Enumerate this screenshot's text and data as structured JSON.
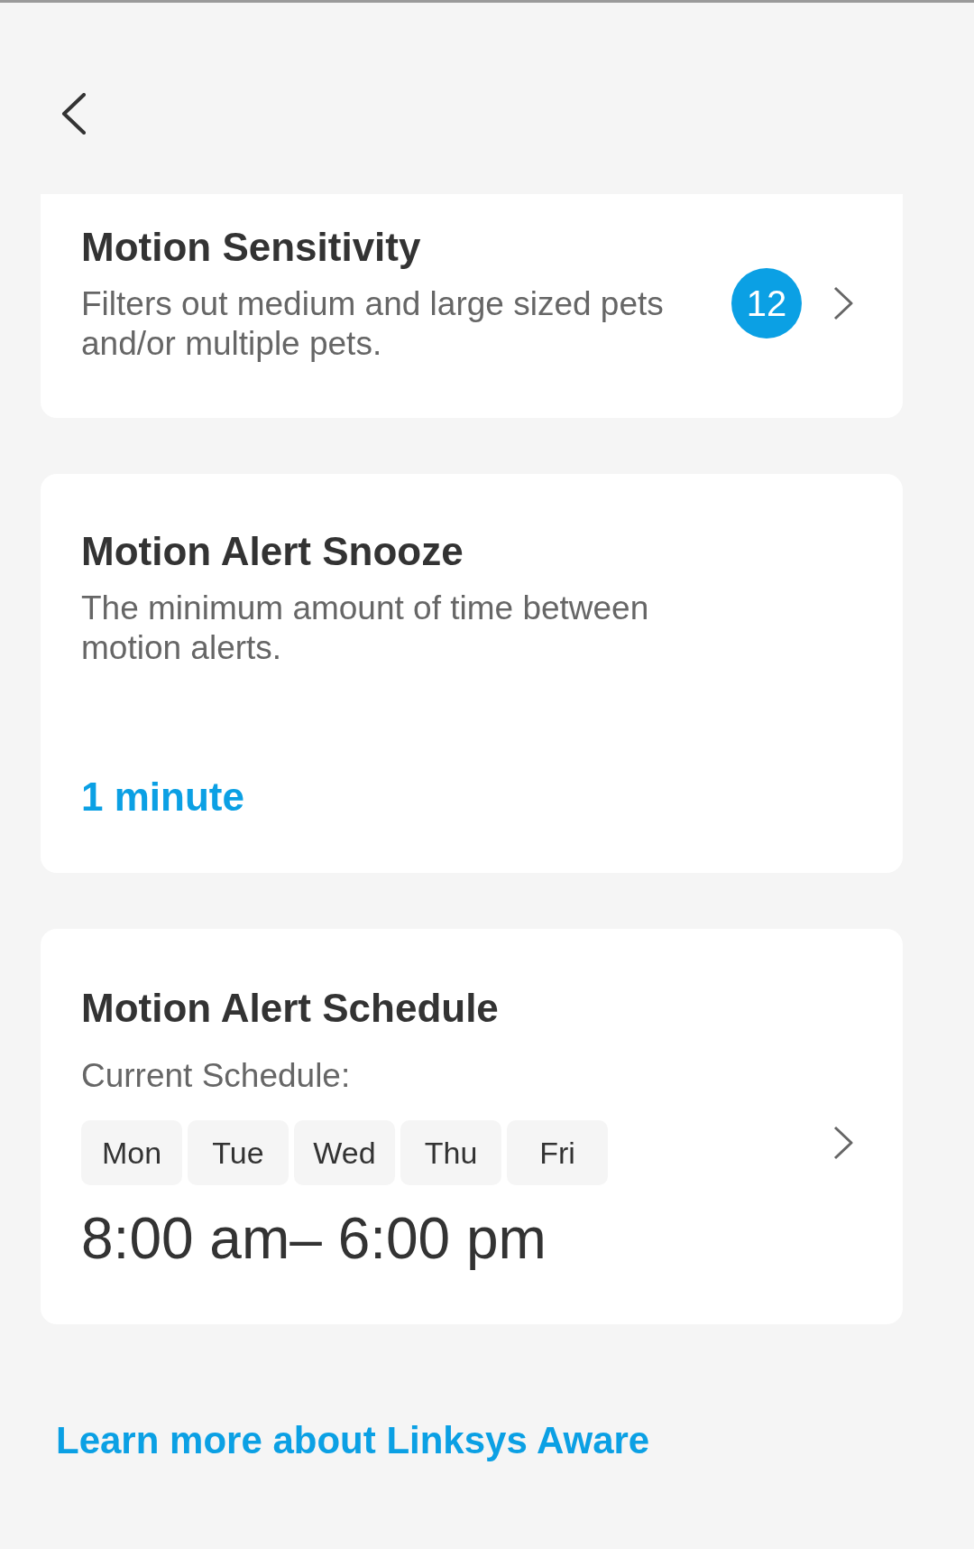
{
  "settings_cards": [
    {
      "kind": "badge",
      "title": "Motion Sensitivity",
      "description": "Filters out medium and large sized pets and/or multiple pets.",
      "badge": "12"
    },
    {
      "kind": "value",
      "title": "Motion Alert Snooze",
      "description": "The minimum amount of time between motion alerts.",
      "value": "1 minute"
    },
    {
      "kind": "schedule",
      "title": "Motion Alert Schedule",
      "subtitle": "Current Schedule:",
      "days": [
        "Mon",
        "Tue",
        "Wed",
        "Thu",
        "Fri"
      ],
      "time_range": "8:00 am– 6:00 pm"
    }
  ],
  "learn_more_link": "Learn more about Linksys Aware"
}
